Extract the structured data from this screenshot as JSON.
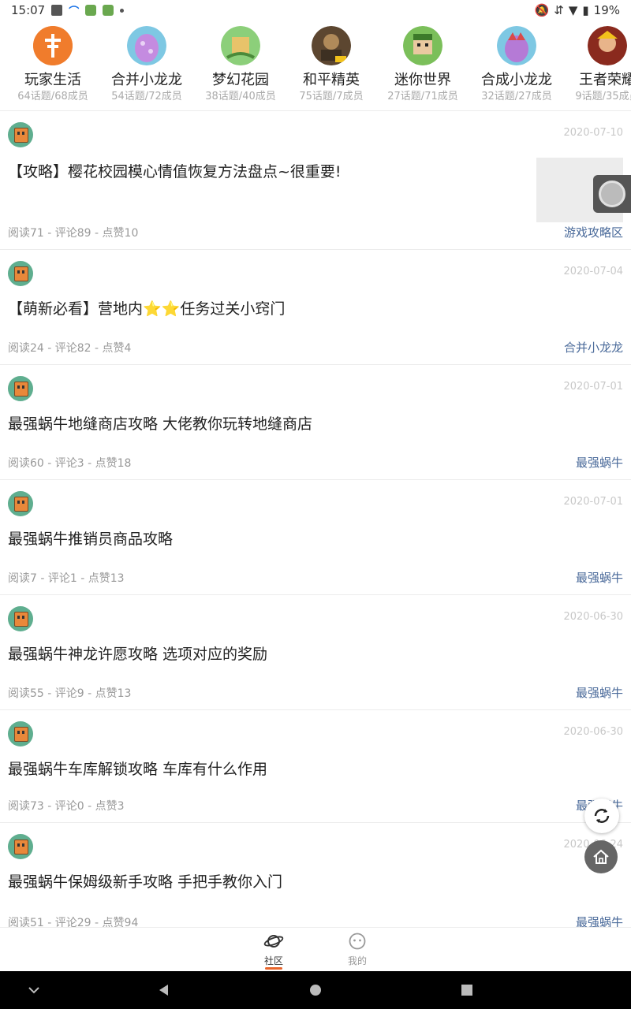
{
  "status_bar": {
    "time": "15:07",
    "battery": "19%"
  },
  "groups": [
    {
      "name": "玩家生活",
      "stats": "64话题/68成员",
      "color": "#f07c2c"
    },
    {
      "name": "合并小龙龙",
      "stats": "54话题/72成员",
      "color": "#c48be0"
    },
    {
      "name": "梦幻花园",
      "stats": "38话题/40成员",
      "color": "#7fb36b"
    },
    {
      "name": "和平精英",
      "stats": "75话题/7成员",
      "color": "#8a6a3c"
    },
    {
      "name": "迷你世界",
      "stats": "27话题/71成员",
      "color": "#5ab34a"
    },
    {
      "name": "合成小龙龙",
      "stats": "32话题/27成员",
      "color": "#b57ad6"
    },
    {
      "name": "王者荣耀",
      "stats": "9话题/35成员",
      "color": "#c0392b"
    }
  ],
  "posts": [
    {
      "date": "2020-07-10",
      "title": "【攻略】樱花校园模心情值恢复方法盘点~很重要!",
      "meta": "阅读71 - 评论89 - 点赞10",
      "tag": "游戏攻略区"
    },
    {
      "date": "2020-07-04",
      "title_pre": "【萌新必看】营地内",
      "title_stars": "⭐⭐",
      "title_post": "任务过关小窍门",
      "meta": "阅读24 - 评论82 - 点赞4",
      "tag": "合并小龙龙"
    },
    {
      "date": "2020-07-01",
      "title": "最强蜗牛地缝商店攻略 大佬教你玩转地缝商店",
      "meta": "阅读60 - 评论3 - 点赞18",
      "tag": "最强蜗牛"
    },
    {
      "date": "2020-07-01",
      "title": "最强蜗牛推销员商品攻略",
      "meta": "阅读7 - 评论1 - 点赞13",
      "tag": "最强蜗牛"
    },
    {
      "date": "2020-06-30",
      "title": "最强蜗牛神龙许愿攻略 选项对应的奖励",
      "meta": "阅读55 - 评论9 - 点赞13",
      "tag": "最强蜗牛"
    },
    {
      "date": "2020-06-30",
      "title": "最强蜗牛车库解锁攻略 车库有什么作用",
      "meta": "阅读73 - 评论0 - 点赞3",
      "tag": "最强蜗牛"
    },
    {
      "date": "2020-06-24",
      "title": "最强蜗牛保姆级新手攻略 手把手教你入门",
      "meta": "阅读51 - 评论29 - 点赞94",
      "tag": "最强蜗牛"
    }
  ],
  "tabs": {
    "community": "社区",
    "mine": "我的"
  },
  "colors": {
    "accent": "#e8642a",
    "tag": "#4a6a9a"
  }
}
